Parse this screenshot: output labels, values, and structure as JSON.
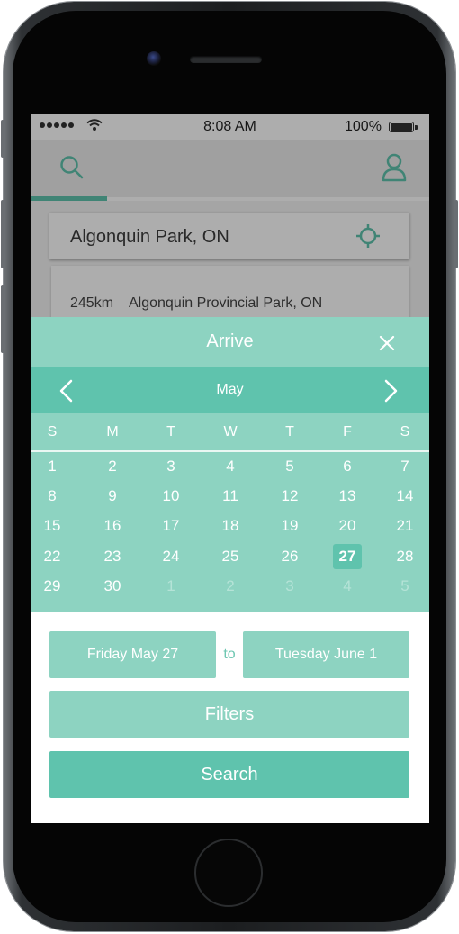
{
  "status_bar": {
    "time": "8:08 AM",
    "battery": "100%"
  },
  "app": {
    "location_value": "Algonquin Park, ON",
    "result": {
      "distance": "245km",
      "name": "Algonquin Provincial Park, ON"
    }
  },
  "modal": {
    "title": "Arrive",
    "month": "May",
    "weekdays": [
      "S",
      "M",
      "T",
      "W",
      "T",
      "F",
      "S"
    ],
    "weeks": [
      [
        "1",
        "2",
        "3",
        "4",
        "5",
        "6",
        "7"
      ],
      [
        "8",
        "9",
        "10",
        "11",
        "12",
        "13",
        "14"
      ],
      [
        "15",
        "16",
        "17",
        "18",
        "19",
        "20",
        "21"
      ],
      [
        "22",
        "23",
        "24",
        "25",
        "26",
        "27",
        "28"
      ],
      [
        "29",
        "30",
        "1",
        "2",
        "3",
        "4",
        "5"
      ]
    ],
    "selected_day": "27",
    "start_date": "Friday May 27",
    "range_separator": "to",
    "end_date": "Tuesday June 1",
    "filters_label": "Filters",
    "search_label": "Search"
  },
  "colors": {
    "accent": "#5fc3ad",
    "accent_light": "#8dd3c1"
  }
}
